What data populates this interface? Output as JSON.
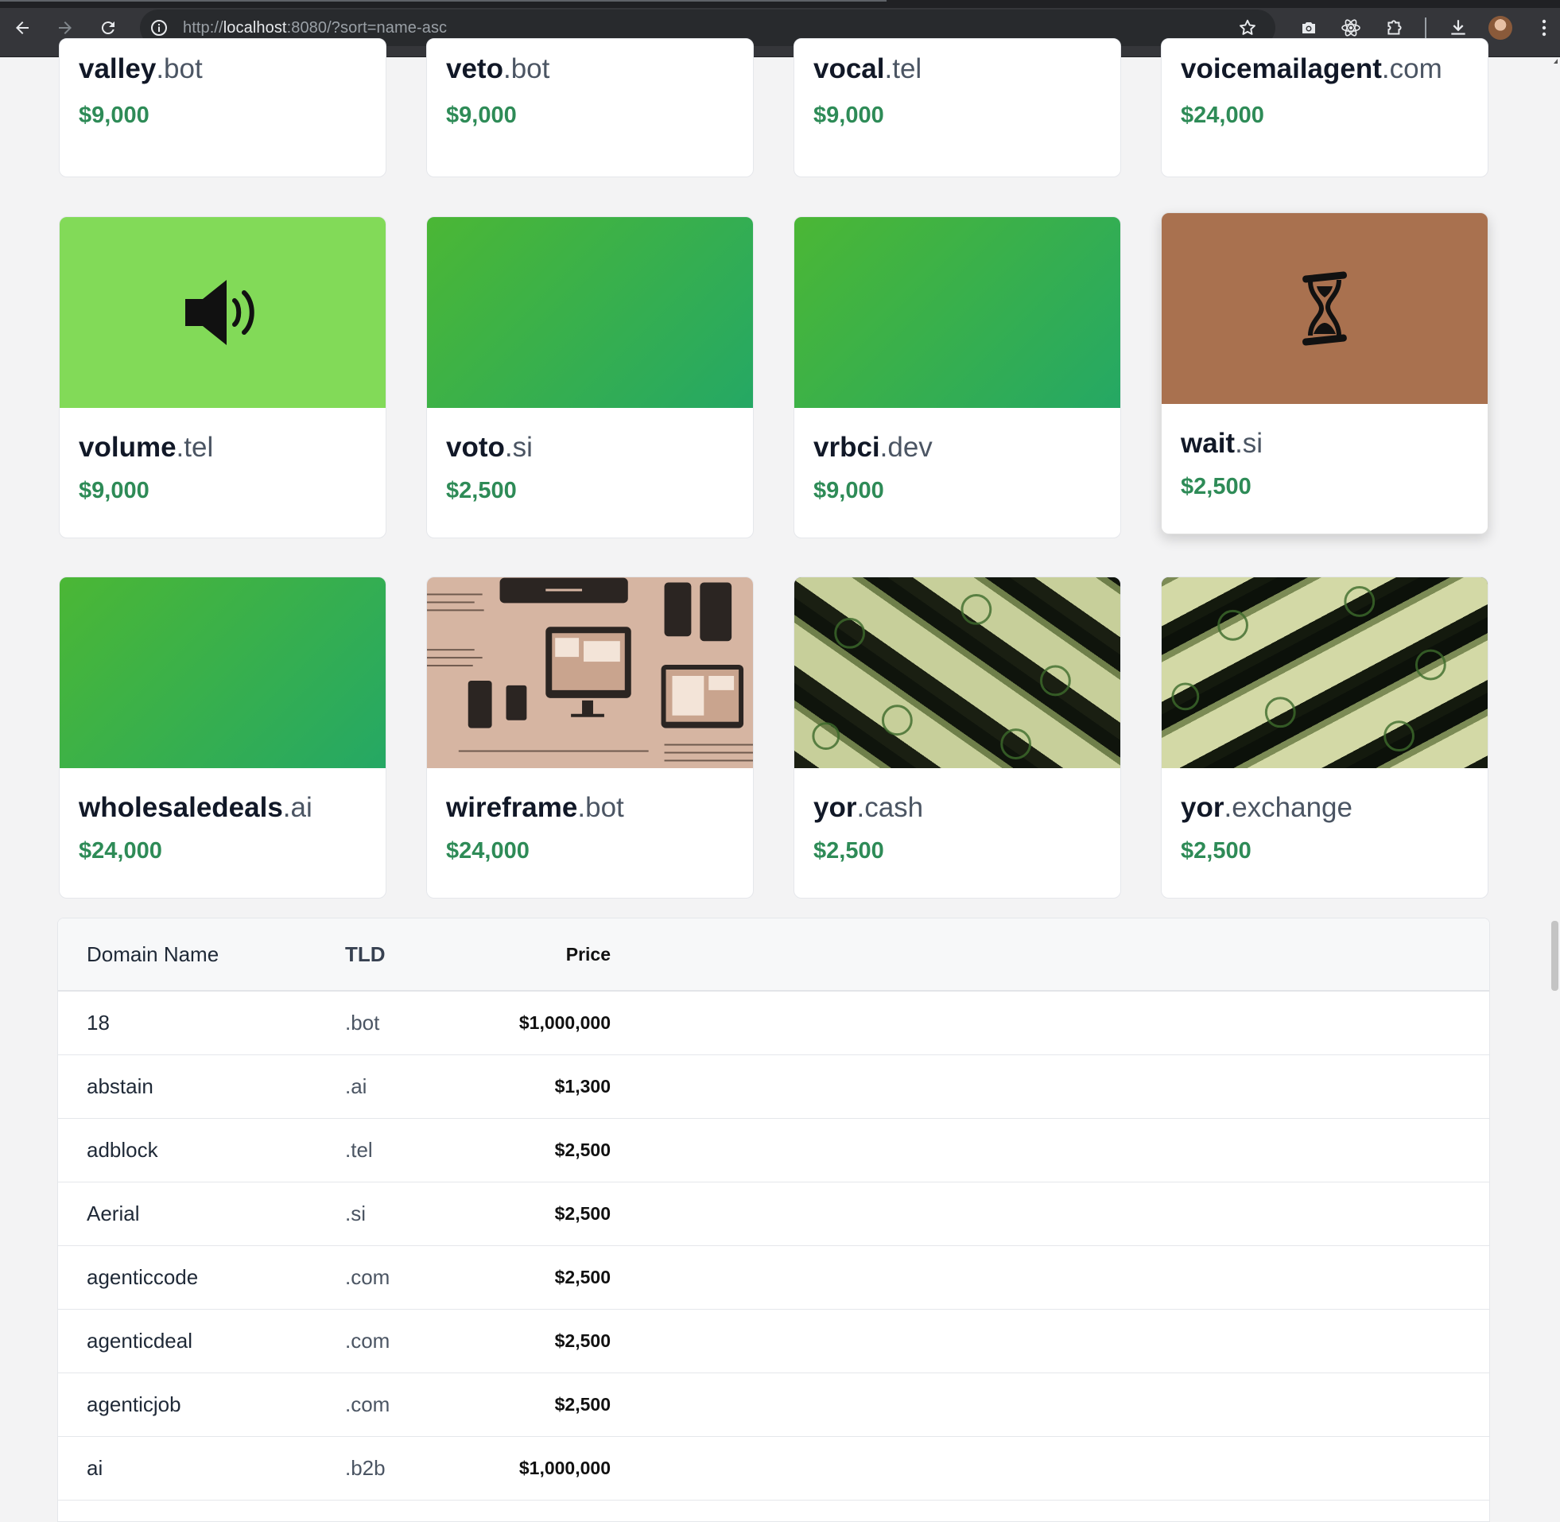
{
  "browser": {
    "url_scheme": "http://",
    "url_host": "localhost",
    "url_rest": ":8080/?sort=name-asc"
  },
  "cards_top_row": [
    {
      "sld": "valley",
      "tld": ".bot",
      "price": "$9,000"
    },
    {
      "sld": "veto",
      "tld": ".bot",
      "price": "$9,000"
    },
    {
      "sld": "vocal",
      "tld": ".tel",
      "price": "$9,000"
    },
    {
      "sld": "voicemailagent",
      "tld": ".com",
      "price": "$24,000"
    }
  ],
  "cards_row2": [
    {
      "sld": "volume",
      "tld": ".tel",
      "price": "$9,000",
      "image": "speaker-icon",
      "bg": "#82da58"
    },
    {
      "sld": "voto",
      "tld": ".si",
      "price": "$2,500",
      "image": "green-gradient"
    },
    {
      "sld": "vrbci",
      "tld": ".dev",
      "price": "$9,000",
      "image": "green-gradient"
    },
    {
      "sld": "wait",
      "tld": ".si",
      "price": "$2,500",
      "image": "hourglass-icon",
      "bg": "#a9714f"
    }
  ],
  "cards_row3": [
    {
      "sld": "wholesaledeals",
      "tld": ".ai",
      "price": "$24,000",
      "image": "green-gradient"
    },
    {
      "sld": "wireframe",
      "tld": ".bot",
      "price": "$24,000",
      "image": "wireframe-illustration"
    },
    {
      "sld": "yor",
      "tld": ".cash",
      "price": "$2,500",
      "image": "money-photo"
    },
    {
      "sld": "yor",
      "tld": ".exchange",
      "price": "$2,500",
      "image": "money-photo"
    }
  ],
  "table": {
    "headers": {
      "name": "Domain Name",
      "tld": "TLD",
      "price": "Price"
    },
    "rows": [
      {
        "name": "18",
        "tld": ".bot",
        "price": "$1,000,000"
      },
      {
        "name": "abstain",
        "tld": ".ai",
        "price": "$1,300"
      },
      {
        "name": "adblock",
        "tld": ".tel",
        "price": "$2,500"
      },
      {
        "name": "Aerial",
        "tld": ".si",
        "price": "$2,500"
      },
      {
        "name": "agenticcode",
        "tld": ".com",
        "price": "$2,500"
      },
      {
        "name": "agenticdeal",
        "tld": ".com",
        "price": "$2,500"
      },
      {
        "name": "agenticjob",
        "tld": ".com",
        "price": "$2,500"
      },
      {
        "name": "ai",
        "tld": ".b2b",
        "price": "$1,000,000"
      }
    ]
  },
  "colors": {
    "price": "#2e8b57",
    "brand_green": "#82da58",
    "wait_bg": "#a9714f"
  }
}
